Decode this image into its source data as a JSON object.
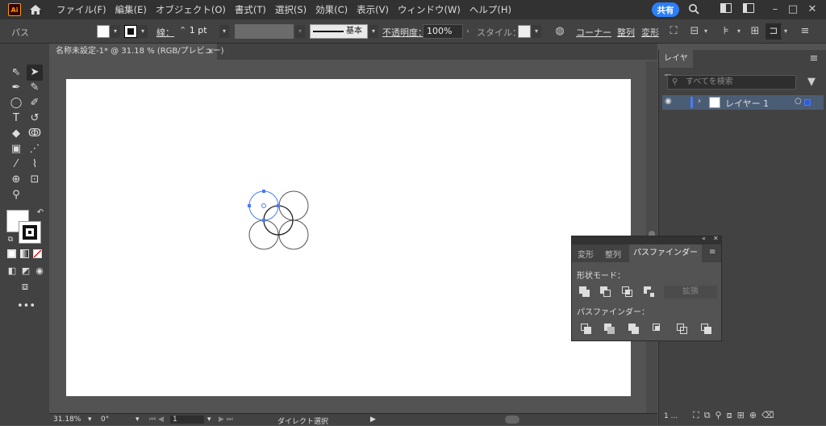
{
  "app": {
    "logo": "Ai",
    "share_label": "共有"
  },
  "menu": [
    "ファイル(F)",
    "編集(E)",
    "オブジェクト(O)",
    "書式(T)",
    "選択(S)",
    "効果(C)",
    "表示(V)",
    "ウィンドウ(W)",
    "ヘルプ(H)"
  ],
  "control_bar": {
    "object_type": "パス",
    "stroke_label": "線：",
    "stroke_weight": "1 pt",
    "brush_label": "基本",
    "opacity_label": "不透明度：",
    "opacity_value": "100%",
    "style_label": "スタイル：",
    "corner_label": "コーナー",
    "align_label": "整列",
    "transform_label": "変形"
  },
  "document": {
    "tab_title": "名称未設定-1* @ 31.18 % (RGB/プレビュー)",
    "close_glyph": "×"
  },
  "status": {
    "zoom": "31.18%",
    "rotation": "0°",
    "artboard": "1",
    "tool": "ダイレクト選択"
  },
  "layers_panel": {
    "tab": "レイヤー",
    "search_placeholder": "すべてを検索",
    "layer_name": "レイヤー 1",
    "footer_count": "1 ..."
  },
  "pathfinder_panel": {
    "tabs": [
      "変形",
      "整列",
      "パスファインダー"
    ],
    "active_tab": "パスファインダー",
    "shape_modes_label": "形状モード：",
    "expand_label": "拡張",
    "pathfinders_label": "パスファインダー："
  },
  "colors": {
    "accent": "#2d7ff9",
    "selection": "#4a7bf7",
    "layer_bar": "#4b5d75"
  }
}
